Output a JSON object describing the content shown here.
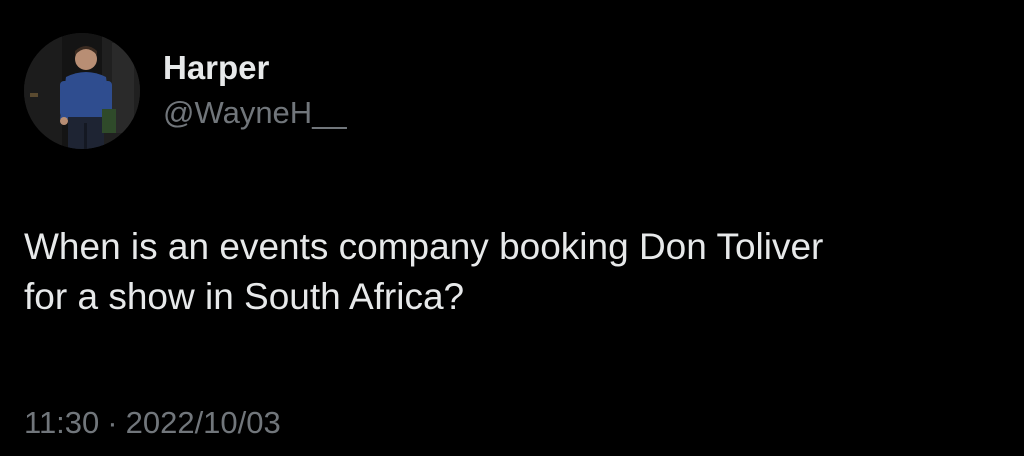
{
  "tweet": {
    "author": {
      "display_name": "Harper",
      "handle": "@WayneH__",
      "avatar_icon": "profile-photo"
    },
    "text": "When is an events company booking Don Toliver\nfor a show in South Africa?",
    "time": "11:30",
    "separator": "·",
    "date": "2022/10/03"
  },
  "colors": {
    "background": "#000000",
    "primary_text": "#e7e9ea",
    "secondary_text": "#71767b"
  }
}
